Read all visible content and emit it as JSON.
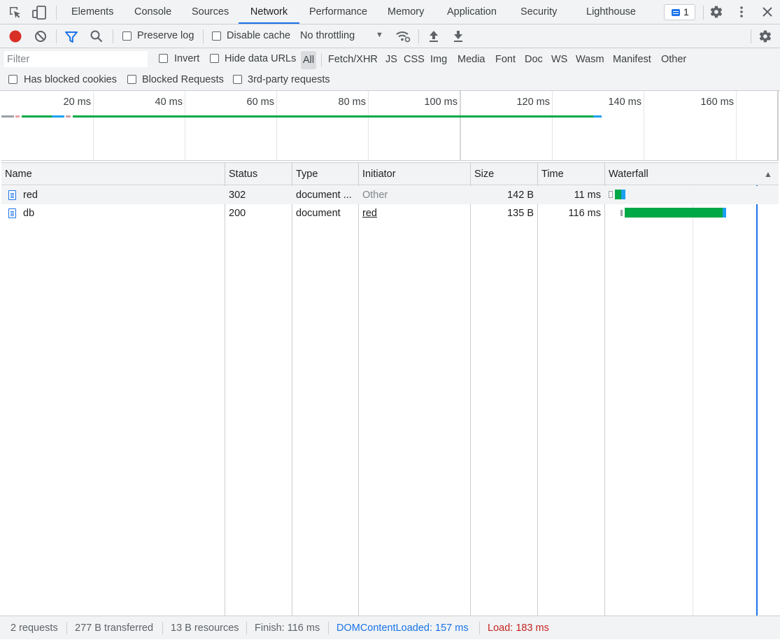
{
  "tabs": [
    {
      "label": "Elements",
      "active": false
    },
    {
      "label": "Console",
      "active": false
    },
    {
      "label": "Sources",
      "active": false
    },
    {
      "label": "Network",
      "active": true
    },
    {
      "label": "Performance",
      "active": false
    },
    {
      "label": "Memory",
      "active": false
    },
    {
      "label": "Application",
      "active": false
    },
    {
      "label": "Security",
      "active": false
    },
    {
      "label": "Lighthouse",
      "active": false
    }
  ],
  "issues_count": "1",
  "toolbar": {
    "preserve_log": "Preserve log",
    "disable_cache": "Disable cache",
    "throttling": "No throttling",
    "throttling_arrow": "▼"
  },
  "filter": {
    "placeholder": "Filter",
    "invert": "Invert",
    "hide_data_urls": "Hide data URLs",
    "types": [
      "All",
      "Fetch/XHR",
      "JS",
      "CSS",
      "Img",
      "Media",
      "Font",
      "Doc",
      "WS",
      "Wasm",
      "Manifest",
      "Other"
    ],
    "selected_type": "All",
    "has_blocked_cookies": "Has blocked cookies",
    "blocked_requests": "Blocked Requests",
    "third_party": "3rd-party requests"
  },
  "overview": {
    "ticks": [
      "20 ms",
      "40 ms",
      "60 ms",
      "80 ms",
      "100 ms",
      "120 ms",
      "140 ms",
      "160 ms"
    ]
  },
  "table": {
    "headers": [
      "Name",
      "Status",
      "Type",
      "Initiator",
      "Size",
      "Time",
      "Waterfall"
    ],
    "sort_indicator": "▲",
    "rows": [
      {
        "name": "red",
        "status": "302",
        "type": "document ...",
        "initiator": "Other",
        "initiator_link": false,
        "size": "142 B",
        "time": "11 ms"
      },
      {
        "name": "db",
        "status": "200",
        "type": "document",
        "initiator": "red",
        "initiator_link": true,
        "size": "135 B",
        "time": "116 ms"
      }
    ]
  },
  "status_bar": {
    "requests": "2 requests",
    "transferred": "277 B transferred",
    "resources": "13 B resources",
    "finish": "Finish: 116 ms",
    "dom_content_loaded": "DOMContentLoaded: 157 ms",
    "load": "Load: 183 ms"
  },
  "colors": {
    "accent": "#1a73e8",
    "record": "#d93025",
    "waiting": "#00a846",
    "download": "#1ba1f2",
    "dcl": "#1a73e8",
    "load": "#c5221f"
  }
}
